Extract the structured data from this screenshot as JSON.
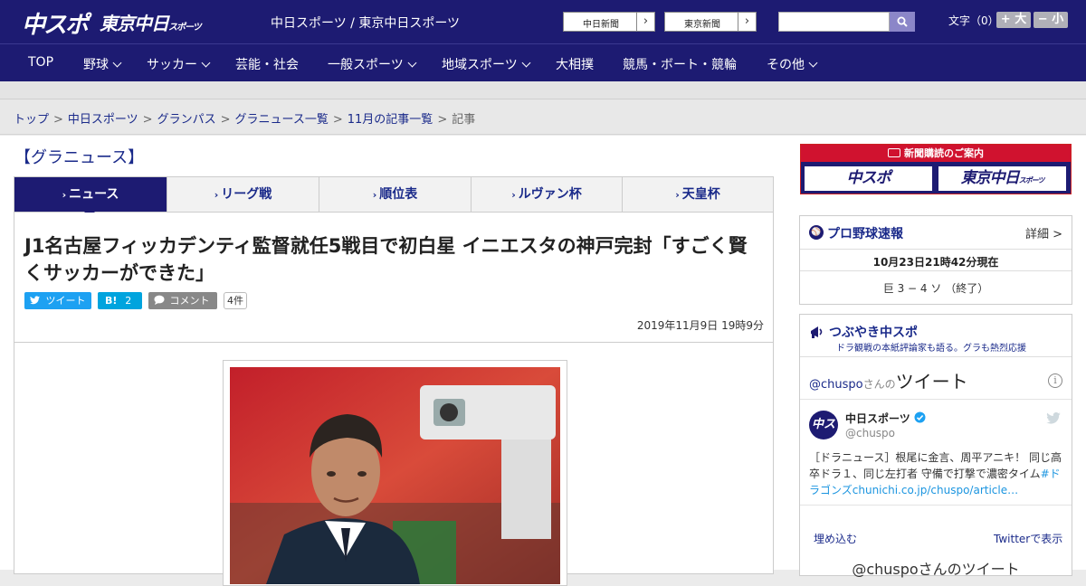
{
  "header": {
    "logo_main": "中スポ",
    "logo_tokyo": "東京中日",
    "logo_tokyo_small": "スポーツ",
    "site_title": "中日スポーツ / 東京中日スポーツ",
    "paper_links": [
      "中日新聞",
      "東京新聞"
    ],
    "search_placeholder": "",
    "font_label": "文字（0）",
    "font_bigger": "+ 大",
    "font_smaller": "− 小"
  },
  "nav": {
    "items": [
      {
        "label": "TOP",
        "dropdown": false
      },
      {
        "label": "野球",
        "dropdown": true
      },
      {
        "label": "サッカー",
        "dropdown": true
      },
      {
        "label": "芸能・社会",
        "dropdown": false
      },
      {
        "label": "一般スポーツ",
        "dropdown": true
      },
      {
        "label": "地域スポーツ",
        "dropdown": true
      },
      {
        "label": "大相撲",
        "dropdown": false
      },
      {
        "label": "競馬・ボート・競輪",
        "dropdown": false
      },
      {
        "label": "その他",
        "dropdown": true
      }
    ]
  },
  "breadcrumb": {
    "items": [
      "トップ",
      "中日スポーツ",
      "グランパス",
      "グラニュース一覧",
      "11月の記事一覧"
    ],
    "current": "記事",
    "separator": ">"
  },
  "section_title": "【グラニュース】",
  "tabs": [
    "ニュース",
    "リーグ戦",
    "順位表",
    "ルヴァン杯",
    "天皇杯"
  ],
  "tab_arrow": "›",
  "article": {
    "headline": "J1名古屋フィッカデンティ監督就任5戦目で初白星 イニエスタの神戸完封「すごく賢くサッカーができた」",
    "share_tweet": "ツイート",
    "share_hatena": "B!",
    "share_hatena_count": "2",
    "share_comment": "コメント",
    "comment_count": "4件",
    "date": "2019年11月9日 19時9分"
  },
  "sidebar": {
    "promo_title": "新聞購読のご案内",
    "promo_logo1": "中スポ",
    "promo_logo2": "東京中日",
    "promo_logo2_small": "スポーツ",
    "baseball": {
      "title": "プロ野球速報",
      "detail_link": "詳細 >",
      "updated": "10月23日21時42分現在",
      "score": "巨 3 − 4 ソ （終了）"
    },
    "tsubuyaki": {
      "title": "つぶやき中スポ",
      "subtitle": "ドラ観戦の本紙評論家も語る。グラも熱烈応援",
      "tweets_header_handle": "@chuspo",
      "tweets_header_san": "さんの",
      "tweets_header_word": "ツイート",
      "account_name": "中日スポーツ",
      "account_handle": "@chuspo",
      "tweet_text": "［ドラニュース］根尾に金言、周平アニキ！ 同じ高卒ドラ１、同じ左打者 守備で打撃で濃密タイム",
      "tweet_hashtag": "#ドラゴンズ",
      "tweet_link": "chunichi.co.jp/chuspo/article…",
      "embed_link": "埋め込む",
      "view_on_twitter": "Twitterで表示",
      "tweets_footer": "@chuspoさんのツイート"
    }
  },
  "colors": {
    "brand_navy": "#1d1b72",
    "promo_red": "#d0122f",
    "link_blue": "#1a2a8a",
    "twitter_blue": "#1da1f2",
    "hatena_blue": "#00a4de"
  }
}
